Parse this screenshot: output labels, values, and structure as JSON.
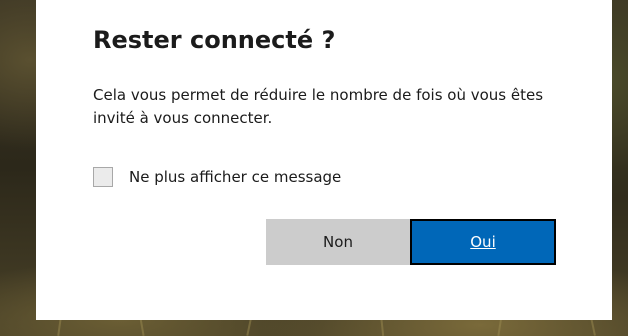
{
  "dialog": {
    "title": "Rester connecté ?",
    "description": "Cela vous permet de réduire le nombre de fois où vous êtes invité à vous connecter.",
    "checkbox": {
      "label": "Ne plus afficher ce message",
      "checked": false
    },
    "buttons": {
      "no_label": "Non",
      "yes_label": "Oui"
    }
  },
  "colors": {
    "primary_button": "#0067b8",
    "secondary_button": "#cccccc",
    "dialog_background": "#ffffff",
    "text": "#1b1b1b"
  }
}
